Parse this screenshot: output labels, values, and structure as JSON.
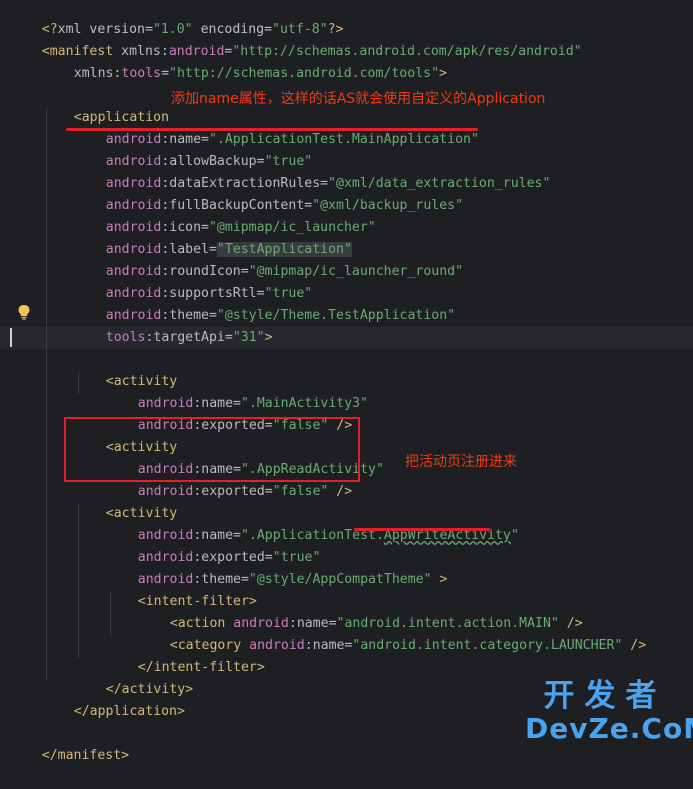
{
  "code": {
    "l1": [
      "<?",
      "xml version=",
      "\"1.0\"",
      " encoding=",
      "\"utf-8\"",
      "?>"
    ],
    "l2": [
      "<manifest ",
      "xmlns:",
      "android",
      "=",
      "\"http://schemas.android.com/apk/res/android\""
    ],
    "l3": [
      "xmlns:",
      "tools",
      "=",
      "\"http://schemas.android.com/tools\"",
      ">"
    ],
    "l5": "<application",
    "l6": [
      "android",
      ":name=",
      "\".ApplicationTest.MainApplication\""
    ],
    "l7": [
      "android",
      ":allowBackup=",
      "\"true\""
    ],
    "l8": [
      "android",
      ":dataExtractionRules=",
      "\"@xml/data_extraction_rules\""
    ],
    "l9": [
      "android",
      ":fullBackupContent=",
      "\"@xml/backup_rules\""
    ],
    "l10": [
      "android",
      ":icon=",
      "\"@mipmap/ic_launcher\""
    ],
    "l11": [
      "android",
      ":label=",
      "\"TestApplication\""
    ],
    "l12": [
      "android",
      ":roundIcon=",
      "\"@mipmap/ic_launcher_round\""
    ],
    "l13": [
      "android",
      ":supportsRtl=",
      "\"true\""
    ],
    "l14": [
      "android",
      ":theme=",
      "\"@style/Theme.TestApplication\""
    ],
    "l15": [
      "tools",
      ":targetApi=",
      "\"31\"",
      ">"
    ],
    "l17": "<activity",
    "l18": [
      "android",
      ":name=",
      "\".MainActivity3\""
    ],
    "l19": [
      "android",
      ":exported=",
      "\"false\"",
      " />"
    ],
    "l20": "<activity",
    "l21": [
      "android",
      ":name=",
      "\".AppReadActivity\""
    ],
    "l22": [
      "android",
      ":exported=",
      "\"false\"",
      " />"
    ],
    "l23": "<activity",
    "l24": [
      "android",
      ":name=",
      "\".ApplicationTest.",
      "AppWriteActivity",
      "\""
    ],
    "l25": [
      "android",
      ":exported=",
      "\"true\""
    ],
    "l26": [
      "android",
      ":theme=",
      "\"@style/AppCompatTheme\"",
      " >"
    ],
    "l27": "<intent-filter>",
    "l28": [
      "<action ",
      "android",
      ":name=",
      "\"android.intent.action.MAIN\"",
      " />"
    ],
    "l29": [
      "<category ",
      "android",
      ":name=",
      "\"android.intent.category.LAUNCHER\"",
      " />"
    ],
    "l30": "</intent-filter>",
    "l31": "</activity>",
    "l32": "</application>",
    "l34": "</manifest>"
  },
  "annotations": {
    "top": "添加name属性，这样的话AS就会使用自定义的Application",
    "middle": "把活动页注册进来"
  },
  "watermark": {
    "top": "开发者",
    "bottom": "DevZe.CoM"
  },
  "colors": {
    "background": "#1e1f22",
    "tag": "#d5b778",
    "namespace": "#c77dbb",
    "value": "#6aab73",
    "annotation": "#f03a17",
    "highlight_box": "#e3202a",
    "watermark": "#4aa3f0"
  },
  "icons": {
    "gutter": "lightbulb-icon"
  }
}
